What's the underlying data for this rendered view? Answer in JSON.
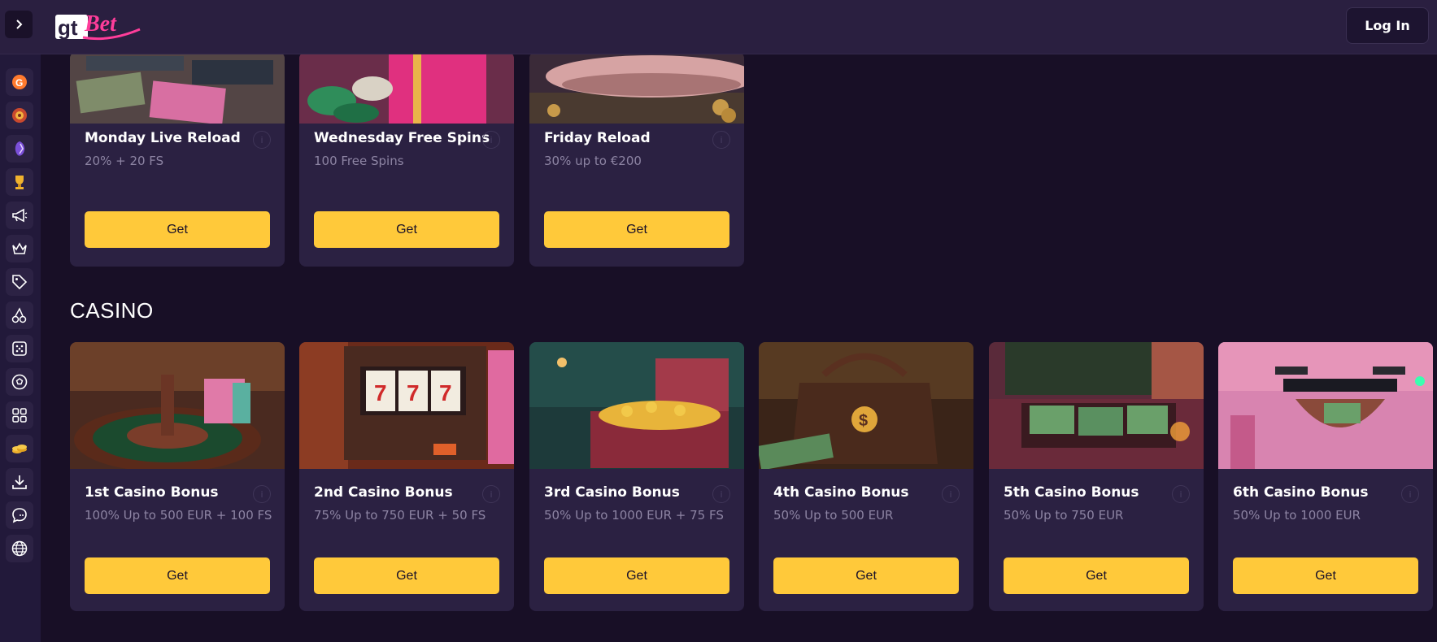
{
  "header": {
    "toggle_icon": "chevron-right-icon",
    "logo_text_left": "gt",
    "logo_text_right": "Bet",
    "login_label": "Log In"
  },
  "sidebar": {
    "icons": [
      "promo-badge-icon",
      "wheel-icon",
      "gem-icon",
      "trophy-icon",
      "megaphone-icon",
      "crown-icon",
      "tag-icon",
      "cherries-icon",
      "dice-icon",
      "soccer-ball-icon",
      "grid-icon",
      "coins-icon",
      "download-icon",
      "chat-icon",
      "globe-icon"
    ]
  },
  "top_cards": [
    {
      "title": "Monday Live Reload",
      "subtitle": "20% + 20 FS",
      "button": "Get"
    },
    {
      "title": "Wednesday Free Spins",
      "subtitle": "100 Free Spins",
      "button": "Get"
    },
    {
      "title": "Friday Reload",
      "subtitle": "30% up to €200",
      "button": "Get"
    }
  ],
  "casino": {
    "section_title": "CASINO",
    "cards": [
      {
        "title": "1st Casino Bonus",
        "subtitle": "100% Up to 500 EUR + 100 FS",
        "button": "Get"
      },
      {
        "title": "2nd Casino Bonus",
        "subtitle": "75% Up to 750 EUR + 50 FS",
        "button": "Get"
      },
      {
        "title": "3rd Casino Bonus",
        "subtitle": "50% Up to 1000 EUR + 75 FS",
        "button": "Get"
      },
      {
        "title": "4th Casino Bonus",
        "subtitle": "50% Up to 500 EUR",
        "button": "Get"
      },
      {
        "title": "5th Casino Bonus",
        "subtitle": "50% Up to 750 EUR",
        "button": "Get"
      },
      {
        "title": "6th Casino Bonus",
        "subtitle": "50% Up to 1000 EUR",
        "button": "Get"
      }
    ]
  },
  "colors": {
    "background": "#180f26",
    "card": "#2b2142",
    "accent_button": "#ffc93a",
    "logo_pink": "#ff3d9a"
  }
}
